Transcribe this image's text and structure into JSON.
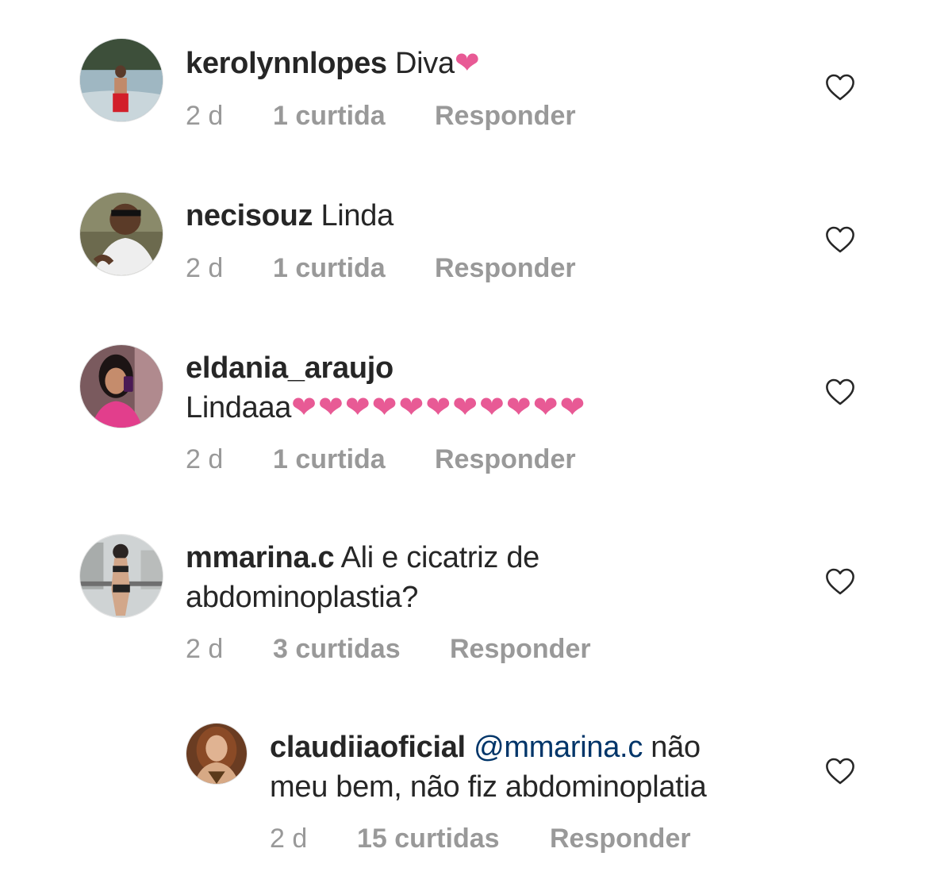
{
  "comments": [
    {
      "username": "kerolynnlopes",
      "text": " Diva",
      "hearts": "❤",
      "time": "2 d",
      "likes": "1 curtida",
      "reply": "Responder"
    },
    {
      "username": "necisouz",
      "text": " Linda",
      "time": "2 d",
      "likes": "1 curtida",
      "reply": "Responder"
    },
    {
      "username": "eldania_araujo",
      "text": "Lindaaa",
      "hearts": "❤❤❤❤❤❤❤❤❤❤❤",
      "time": "2 d",
      "likes": "1 curtida",
      "reply": "Responder"
    },
    {
      "username": "mmarina.c",
      "text_line1": " Ali e cicatriz de",
      "text_line2": "abdominoplastia?",
      "time": "2 d",
      "likes": "3 curtidas",
      "reply": "Responder"
    },
    {
      "username": "claudiiaoficial",
      "mention": "@mmarina.c",
      "text_line1": " não",
      "text_line2": "meu bem, não fiz abdominoplatia",
      "time": "2 d",
      "likes": "15 curtidas",
      "reply": "Responder"
    }
  ],
  "colors": {
    "username": "#262626",
    "meta": "#999999",
    "mention": "#003569",
    "heart_emoji": "#e85a95",
    "like_icon": "#262626"
  },
  "icons": {
    "like": "heart-outline-icon"
  }
}
